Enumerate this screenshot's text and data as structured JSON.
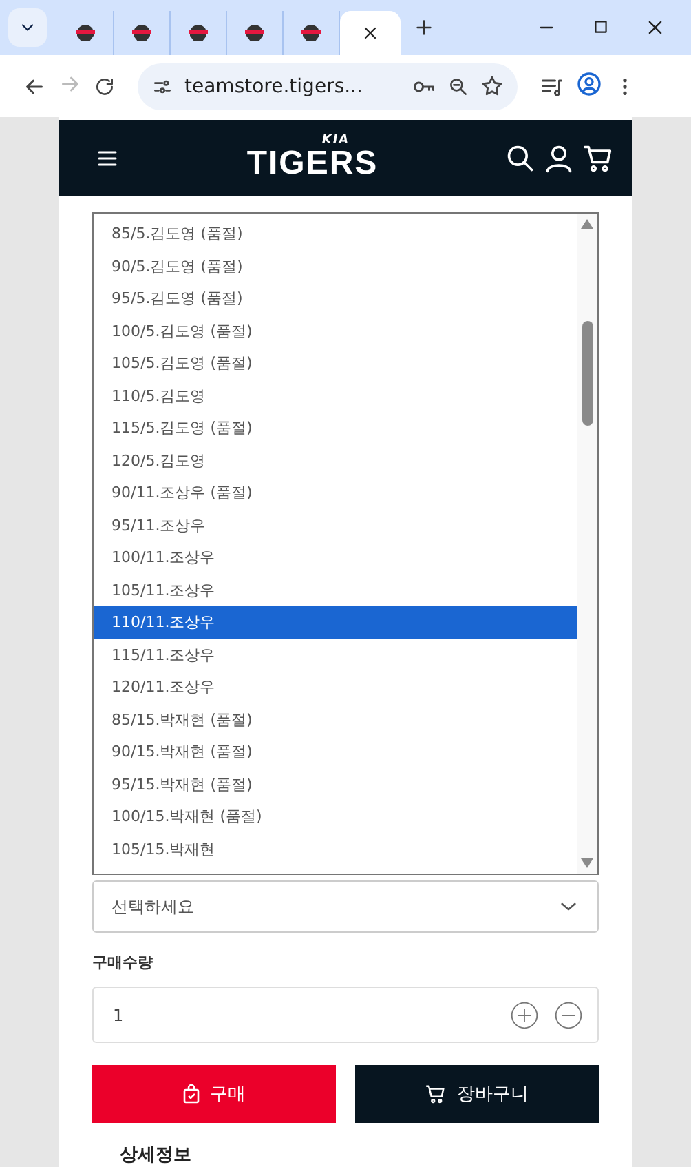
{
  "browser": {
    "tabs": [
      {
        "selected": false
      },
      {
        "selected": false
      },
      {
        "selected": false
      },
      {
        "selected": false
      },
      {
        "selected": false
      },
      {
        "selected": true
      }
    ],
    "url": "teamstore.tigers..."
  },
  "header": {
    "logo_mark": "KIA",
    "logo": "TIGERS"
  },
  "size_listbox": {
    "options": [
      {
        "label": "85/5.김도영 (품절)",
        "selected": false
      },
      {
        "label": "90/5.김도영 (품절)",
        "selected": false
      },
      {
        "label": "95/5.김도영 (품절)",
        "selected": false
      },
      {
        "label": "100/5.김도영 (품절)",
        "selected": false
      },
      {
        "label": "105/5.김도영 (품절)",
        "selected": false
      },
      {
        "label": "110/5.김도영",
        "selected": false
      },
      {
        "label": "115/5.김도영 (품절)",
        "selected": false
      },
      {
        "label": "120/5.김도영",
        "selected": false
      },
      {
        "label": "90/11.조상우 (품절)",
        "selected": false
      },
      {
        "label": "95/11.조상우",
        "selected": false
      },
      {
        "label": "100/11.조상우",
        "selected": false
      },
      {
        "label": "105/11.조상우",
        "selected": false
      },
      {
        "label": "110/11.조상우",
        "selected": true
      },
      {
        "label": "115/11.조상우",
        "selected": false
      },
      {
        "label": "120/11.조상우",
        "selected": false
      },
      {
        "label": "85/15.박재현 (품절)",
        "selected": false
      },
      {
        "label": "90/15.박재현 (품절)",
        "selected": false
      },
      {
        "label": "95/15.박재현 (품절)",
        "selected": false
      },
      {
        "label": "100/15.박재현 (품절)",
        "selected": false
      },
      {
        "label": "105/15.박재현",
        "selected": false
      }
    ]
  },
  "option_select": {
    "placeholder": "선택하세요"
  },
  "quantity": {
    "label": "구매수량",
    "value": "1"
  },
  "buttons": [
    {
      "kind": "buy",
      "label": "구매"
    },
    {
      "kind": "cart",
      "label": "장바구니"
    }
  ],
  "section_title": "상세정보"
}
